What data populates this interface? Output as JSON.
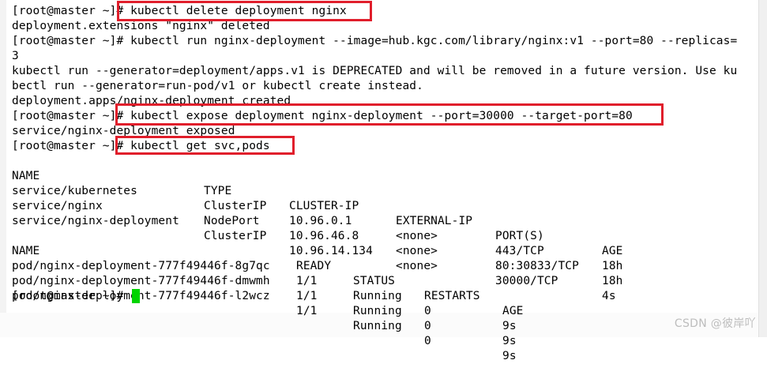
{
  "terminal": {
    "lines": [
      "[root@master ~]# kubectl delete deployment nginx",
      "deployment.extensions \"nginx\" deleted",
      "[root@master ~]# kubectl run nginx-deployment --image=hub.kgc.com/library/nginx:v1 --port=80 --replicas=",
      "3",
      "kubectl run --generator=deployment/apps.v1 is DEPRECATED and will be removed in a future version. Use ku",
      "bectl run --generator=run-pod/v1 or kubectl create instead.",
      "deployment.apps/nginx-deployment created",
      "[root@master ~]# kubectl expose deployment nginx-deployment --port=30000 --target-port=80",
      "service/nginx-deployment exposed",
      "[root@master ~]# kubectl get svc,pods"
    ],
    "svc_headers": [
      "NAME",
      "TYPE",
      "CLUSTER-IP",
      "EXTERNAL-IP",
      "PORT(S)",
      "AGE"
    ],
    "svc_rows": [
      [
        "service/kubernetes",
        "ClusterIP",
        "10.96.0.1",
        "<none>",
        "443/TCP",
        "18h"
      ],
      [
        "service/nginx",
        "NodePort",
        "10.96.46.8",
        "<none>",
        "80:30833/TCP",
        "18h"
      ],
      [
        "service/nginx-deployment",
        "ClusterIP",
        "10.96.14.134",
        "<none>",
        "30000/TCP",
        "4s"
      ]
    ],
    "pod_headers": [
      "NAME",
      "READY",
      "STATUS",
      "RESTARTS",
      "AGE"
    ],
    "pod_rows": [
      [
        "pod/nginx-deployment-777f49446f-8g7qc",
        "1/1",
        "Running",
        "0",
        "9s"
      ],
      [
        "pod/nginx-deployment-777f49446f-dmwmh",
        "1/1",
        "Running",
        "0",
        "9s"
      ],
      [
        "pod/nginx-deployment-777f49446f-l2wcz",
        "1/1",
        "Running",
        "0",
        "9s"
      ]
    ],
    "final_prompt": "[root@master ~]#"
  },
  "colors": {
    "highlight": "#e01e2b",
    "cursor": "#00d400"
  },
  "watermark": "CSDN @彼岸吖"
}
